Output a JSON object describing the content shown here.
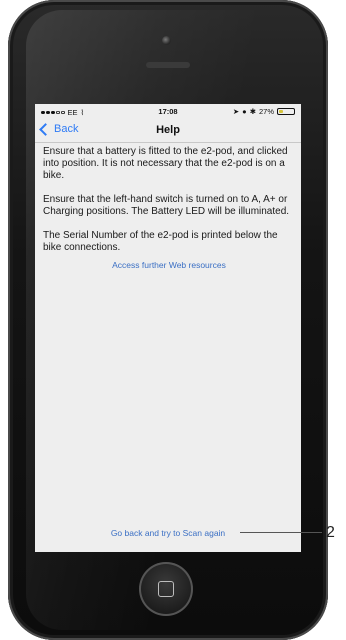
{
  "status": {
    "carrier": "EE",
    "time": "17:08",
    "battery": "27%",
    "battery_level": 0.27
  },
  "nav": {
    "back_label": "Back",
    "title": "Help"
  },
  "content": {
    "paragraphs": [
      "Ensure that a battery is fitted to the e2-pod, and clicked into position. It is not necessary that the e2-pod is on a bike.",
      "Ensure that the left-hand switch is turned on to A, A+ or Charging positions. The Battery LED will be illuminated.",
      "The Serial Number of the e2-pod is printed below the bike connections."
    ],
    "web_link": "Access further Web resources",
    "scan_again_link": "Go back and try to Scan again"
  },
  "callout": {
    "number": "2"
  },
  "colors": {
    "link": "#3a6fc4",
    "back": "#2f7bf5",
    "screen_bg": "#eeeeee"
  }
}
